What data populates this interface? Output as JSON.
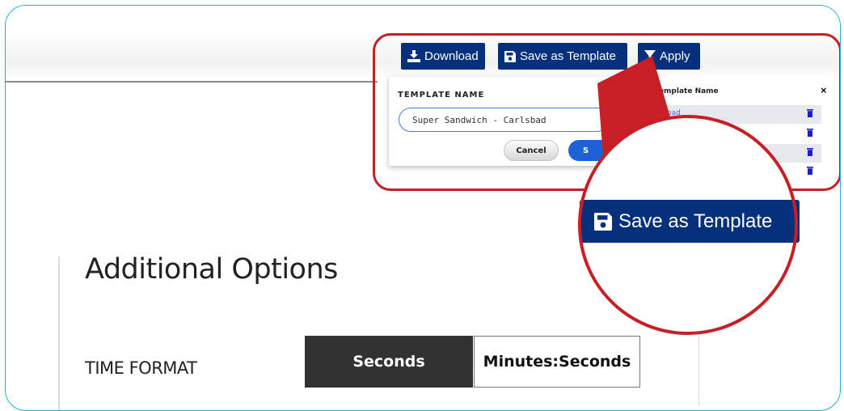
{
  "toolbar": {
    "download_label": "Download",
    "save_template_label": "Save as Template",
    "apply_label": "Apply"
  },
  "template_form": {
    "label": "TEMPLATE NAME",
    "name_value": "Super Sandwich - Carlsbad",
    "cancel_label": "Cancel",
    "submit_label_visible": "S"
  },
  "template_list": {
    "header": "Template Name",
    "close_symbol": "×",
    "items": [
      {
        "name_visible": "rlsbad"
      },
      {
        "name_visible": ""
      },
      {
        "name_visible": ""
      },
      {
        "name_visible": ""
      }
    ]
  },
  "zoom": {
    "save_template_label": "Save as Template"
  },
  "section": {
    "title": "Additional Options",
    "time_format_label": "TIME FORMAT",
    "options": [
      {
        "label": "Seconds",
        "selected": true
      },
      {
        "label": "Minutes:Seconds",
        "selected": false
      }
    ]
  },
  "colors": {
    "primary_button": "#05307b",
    "callout_red": "#c81e25",
    "frame_border": "#1fb0d8",
    "selected_segment": "#323232",
    "link_blue": "#5b5bd6",
    "trash_blue": "#1b1bd1"
  },
  "icons": {
    "download": "download-icon",
    "save": "save-floppy-icon",
    "apply": "filter-icon",
    "delete": "trash-icon",
    "close": "close-icon"
  }
}
